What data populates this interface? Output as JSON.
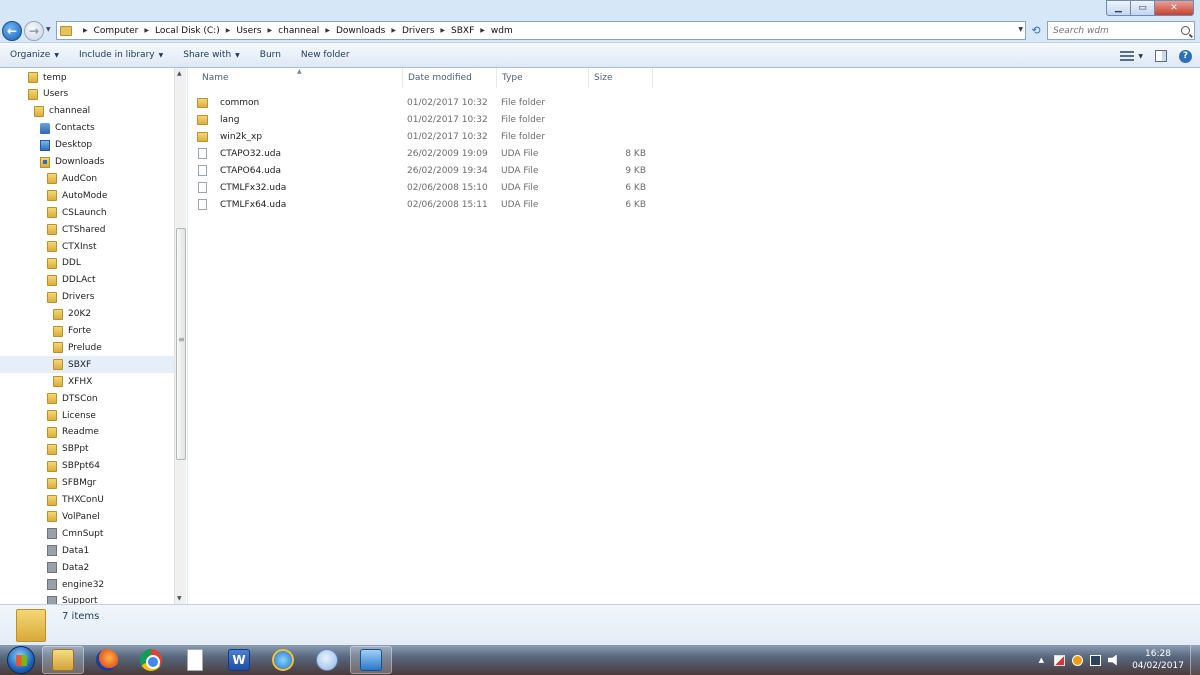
{
  "address": {
    "breadcrumbs": [
      "Computer",
      "Local Disk (C:)",
      "Users",
      "channeal",
      "Downloads",
      "Drivers",
      "SBXF",
      "wdm"
    ]
  },
  "search": {
    "placeholder": "Search wdm"
  },
  "toolbar": {
    "organize": "Organize",
    "include_in_library": "Include in library",
    "share_with": "Share with",
    "burn": "Burn",
    "new_folder": "New folder",
    "help": "?"
  },
  "nav": {
    "items": [
      {
        "label": "temp",
        "icon": "folder-icon",
        "indent": 28
      },
      {
        "label": "Users",
        "icon": "folder-icon",
        "indent": 28
      },
      {
        "label": "channeal",
        "icon": "folder-icon",
        "indent": 34
      },
      {
        "label": "Contacts",
        "icon": "contacts-icon",
        "indent": 40
      },
      {
        "label": "Desktop",
        "icon": "desktop-icon",
        "indent": 40
      },
      {
        "label": "Downloads",
        "icon": "downloads-icon",
        "indent": 40
      },
      {
        "label": "AudCon",
        "icon": "folder-icon",
        "indent": 47
      },
      {
        "label": "AutoMode",
        "icon": "folder-icon",
        "indent": 47
      },
      {
        "label": "CSLaunch",
        "icon": "folder-icon",
        "indent": 47
      },
      {
        "label": "CTShared",
        "icon": "folder-icon",
        "indent": 47
      },
      {
        "label": "CTXInst",
        "icon": "folder-icon",
        "indent": 47
      },
      {
        "label": "DDL",
        "icon": "folder-icon",
        "indent": 47
      },
      {
        "label": "DDLAct",
        "icon": "folder-icon",
        "indent": 47
      },
      {
        "label": "Drivers",
        "icon": "folder-icon",
        "indent": 47
      },
      {
        "label": "20K2",
        "icon": "folder-icon",
        "indent": 53
      },
      {
        "label": "Forte",
        "icon": "folder-icon",
        "indent": 53
      },
      {
        "label": "Prelude",
        "icon": "folder-icon",
        "indent": 53
      },
      {
        "label": "SBXF",
        "icon": "folder-icon",
        "indent": 53,
        "selected": true
      },
      {
        "label": "XFHX",
        "icon": "folder-icon",
        "indent": 53
      },
      {
        "label": "DTSCon",
        "icon": "folder-icon",
        "indent": 47
      },
      {
        "label": "License",
        "icon": "folder-icon",
        "indent": 47
      },
      {
        "label": "Readme",
        "icon": "folder-icon",
        "indent": 47
      },
      {
        "label": "SBPpt",
        "icon": "folder-icon",
        "indent": 47
      },
      {
        "label": "SBPpt64",
        "icon": "folder-icon",
        "indent": 47
      },
      {
        "label": "SFBMgr",
        "icon": "folder-icon",
        "indent": 47
      },
      {
        "label": "THXConU",
        "icon": "folder-icon",
        "indent": 47
      },
      {
        "label": "VolPanel",
        "icon": "folder-icon",
        "indent": 47
      },
      {
        "label": "CmnSupt",
        "icon": "file-icon",
        "indent": 47
      },
      {
        "label": "Data1",
        "icon": "file-icon",
        "indent": 47
      },
      {
        "label": "Data2",
        "icon": "file-icon",
        "indent": 47
      },
      {
        "label": "engine32",
        "icon": "file-icon",
        "indent": 47
      },
      {
        "label": "Support",
        "icon": "file-icon",
        "indent": 47
      }
    ]
  },
  "files": {
    "columns": [
      "Name",
      "Date modified",
      "Type",
      "Size"
    ],
    "rows": [
      {
        "name": "common",
        "date": "01/02/2017 10:32",
        "type": "File folder",
        "size": "",
        "icon": "folder-icon"
      },
      {
        "name": "lang",
        "date": "01/02/2017 10:32",
        "type": "File folder",
        "size": "",
        "icon": "folder-icon"
      },
      {
        "name": "win2k_xp",
        "date": "01/02/2017 10:32",
        "type": "File folder",
        "size": "",
        "icon": "folder-icon"
      },
      {
        "name": "CTAPO32.uda",
        "date": "26/02/2009 19:09",
        "type": "UDA File",
        "size": "8 KB",
        "icon": "file-icon"
      },
      {
        "name": "CTAPO64.uda",
        "date": "26/02/2009 19:34",
        "type": "UDA File",
        "size": "9 KB",
        "icon": "file-icon"
      },
      {
        "name": "CTMLFx32.uda",
        "date": "02/06/2008 15:10",
        "type": "UDA File",
        "size": "6 KB",
        "icon": "file-icon"
      },
      {
        "name": "CTMLFx64.uda",
        "date": "02/06/2008 15:11",
        "type": "UDA File",
        "size": "6 KB",
        "icon": "file-icon"
      }
    ]
  },
  "details": {
    "count": "7 items"
  },
  "taskbar": {
    "word_letter": "W",
    "clock_time": "16:28",
    "clock_date": "04/02/2017"
  }
}
